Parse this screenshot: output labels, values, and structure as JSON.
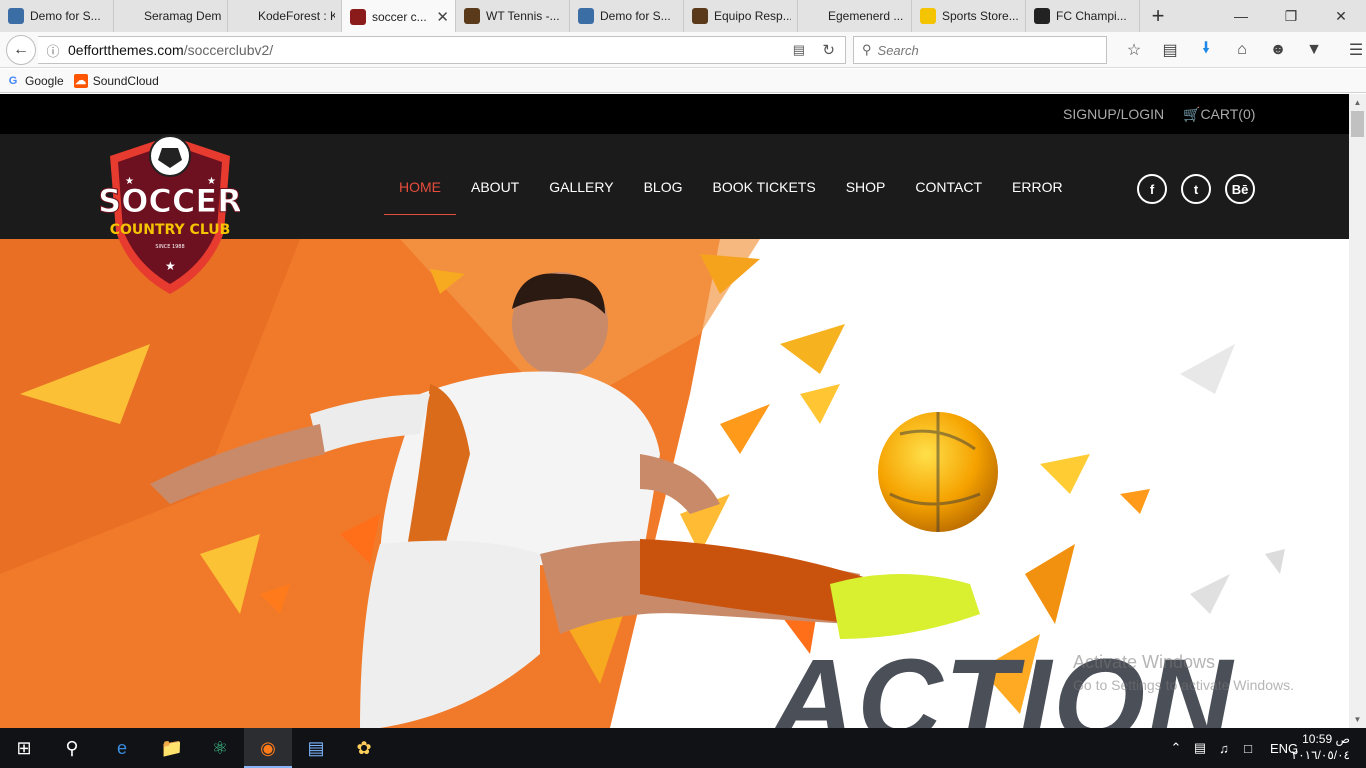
{
  "browser": {
    "tabs": [
      {
        "label": "Demo for S...",
        "icon": "mask-icon",
        "icon_color": "#3b6ea5",
        "active": false
      },
      {
        "label": "Seramag Demo ...",
        "icon": "blank-page-icon",
        "icon_color": "#e3e3e3",
        "active": false
      },
      {
        "label": "KodeForest : Kic...",
        "icon": "blank-page-icon",
        "icon_color": "#e3e3e3",
        "active": false
      },
      {
        "label": "soccer c...",
        "icon": "shield-icon",
        "icon_color": "#8b1a1a",
        "active": true
      },
      {
        "label": "WT Tennis -...",
        "icon": "tennis-icon",
        "icon_color": "#5a3a1a",
        "active": false
      },
      {
        "label": "Demo for S...",
        "icon": "mask-icon",
        "icon_color": "#3b6ea5",
        "active": false
      },
      {
        "label": "Equipo Resp...",
        "icon": "team-icon",
        "icon_color": "#5a3a1a",
        "active": false
      },
      {
        "label": "Egemenerd ...",
        "icon": "blank-page-icon",
        "icon_color": "#e3e3e3",
        "active": false
      },
      {
        "label": "Sports Store...",
        "icon": "bolt-icon",
        "icon_color": "#f5c400",
        "active": false
      },
      {
        "label": "FC Champi...",
        "icon": "soccer-ball-icon",
        "icon_color": "#222222",
        "active": false
      }
    ],
    "new_tab": "+",
    "url_host": "0effortthemes.com",
    "url_path": "/soccerclubv2/",
    "search_placeholder": "Search",
    "bookmarks": [
      {
        "label": "Google",
        "icon": "google-icon",
        "color": "#4285f4"
      },
      {
        "label": "SoundCloud",
        "icon": "soundcloud-icon",
        "color": "#ff5500"
      }
    ]
  },
  "site": {
    "signup_label": "SIGNUP/LOGIN",
    "cart_label": "CART(0)",
    "logo": {
      "line1": "SOCCER",
      "line2": "COUNTRY CLUB",
      "since": "SINCE 1988"
    },
    "nav": [
      {
        "label": "HOME",
        "active": true
      },
      {
        "label": "ABOUT",
        "active": false
      },
      {
        "label": "GALLERY",
        "active": false
      },
      {
        "label": "BLOG",
        "active": false
      },
      {
        "label": "BOOK TICKETS",
        "active": false
      },
      {
        "label": "SHOP",
        "active": false
      },
      {
        "label": "CONTACT",
        "active": false
      },
      {
        "label": "ERROR",
        "active": false
      }
    ],
    "social": [
      {
        "name": "facebook-icon",
        "glyph": "f"
      },
      {
        "name": "twitter-icon",
        "glyph": "t"
      },
      {
        "name": "behance-icon",
        "glyph": "Bē"
      }
    ],
    "headline": "ACTION",
    "accent_color": "#e74c3c",
    "hero_orange": "#f07a2a"
  },
  "watermark": {
    "line1": "Activate Windows",
    "line2": "Go to Settings to activate Windows."
  },
  "taskbar": {
    "language": "ENG",
    "time": "10:59 ص",
    "date": "٢٠١٦/٠٥/٠٤"
  }
}
